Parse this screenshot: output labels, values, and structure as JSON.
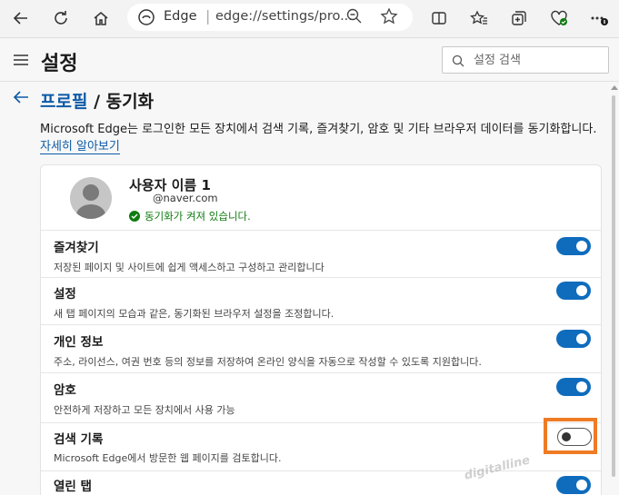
{
  "browser": {
    "app_name": "Edge",
    "url": "edge://settings/pro..."
  },
  "header": {
    "title": "설정",
    "search_placeholder": "설정 검색"
  },
  "breadcrumb": {
    "parent": "프로필",
    "separator": "/",
    "current": "동기화"
  },
  "description": {
    "text": "Microsoft Edge는 로그인한 모든 장치에서 검색 기록, 즐겨찾기, 암호 및 기타 브라우저 데이터를 동기화합니다.",
    "more_link": "자세히 알아보기"
  },
  "profile": {
    "name": "사용자 이름 1",
    "email": "@naver.com",
    "sync_status": "동기화가 켜져 있습니다."
  },
  "sync_items": [
    {
      "title": "즐겨찾기",
      "desc": "저장된 페이지 및 사이트에 쉽게 액세스하고 구성하고 관리합니다",
      "enabled": true
    },
    {
      "title": "설정",
      "desc": "새 탭 페이지의 모습과 같은, 동기화된 브라우저 설정을 조정합니다.",
      "enabled": true
    },
    {
      "title": "개인 정보",
      "desc": "주소, 라이선스, 여권 번호 등의 정보를 저장하여 온라인 양식을 자동으로 작성할 수 있도록 지원합니다.",
      "enabled": true
    },
    {
      "title": "암호",
      "desc": "안전하게 저장하고 모든 장치에서 사용 가능",
      "enabled": true
    },
    {
      "title": "검색 기록",
      "desc": "Microsoft Edge에서 방문한 웹 페이지를 검토합니다.",
      "enabled": false
    },
    {
      "title": "열린 탭",
      "desc": "",
      "enabled": true
    }
  ],
  "watermark": "digitalline",
  "colors": {
    "accent": "#0f6cbd",
    "link": "#0e5aa7",
    "success": "#107c10",
    "highlight": "#ef7b24"
  }
}
